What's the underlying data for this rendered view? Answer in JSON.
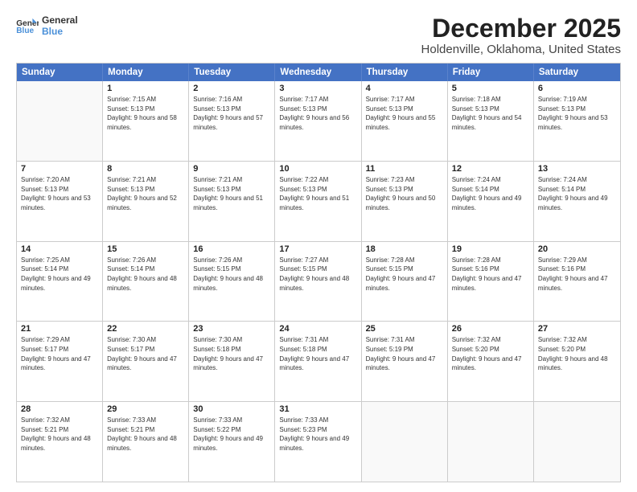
{
  "header": {
    "logo_line1": "General",
    "logo_line2": "Blue",
    "title": "December 2025",
    "subtitle": "Holdenville, Oklahoma, United States"
  },
  "days_of_week": [
    "Sunday",
    "Monday",
    "Tuesday",
    "Wednesday",
    "Thursday",
    "Friday",
    "Saturday"
  ],
  "weeks": [
    [
      {
        "day": "",
        "empty": true
      },
      {
        "day": "1",
        "sunrise": "7:15 AM",
        "sunset": "5:13 PM",
        "daylight": "9 hours and 58 minutes."
      },
      {
        "day": "2",
        "sunrise": "7:16 AM",
        "sunset": "5:13 PM",
        "daylight": "9 hours and 57 minutes."
      },
      {
        "day": "3",
        "sunrise": "7:17 AM",
        "sunset": "5:13 PM",
        "daylight": "9 hours and 56 minutes."
      },
      {
        "day": "4",
        "sunrise": "7:17 AM",
        "sunset": "5:13 PM",
        "daylight": "9 hours and 55 minutes."
      },
      {
        "day": "5",
        "sunrise": "7:18 AM",
        "sunset": "5:13 PM",
        "daylight": "9 hours and 54 minutes."
      },
      {
        "day": "6",
        "sunrise": "7:19 AM",
        "sunset": "5:13 PM",
        "daylight": "9 hours and 53 minutes."
      }
    ],
    [
      {
        "day": "7",
        "sunrise": "7:20 AM",
        "sunset": "5:13 PM",
        "daylight": "9 hours and 53 minutes."
      },
      {
        "day": "8",
        "sunrise": "7:21 AM",
        "sunset": "5:13 PM",
        "daylight": "9 hours and 52 minutes."
      },
      {
        "day": "9",
        "sunrise": "7:21 AM",
        "sunset": "5:13 PM",
        "daylight": "9 hours and 51 minutes."
      },
      {
        "day": "10",
        "sunrise": "7:22 AM",
        "sunset": "5:13 PM",
        "daylight": "9 hours and 51 minutes."
      },
      {
        "day": "11",
        "sunrise": "7:23 AM",
        "sunset": "5:13 PM",
        "daylight": "9 hours and 50 minutes."
      },
      {
        "day": "12",
        "sunrise": "7:24 AM",
        "sunset": "5:14 PM",
        "daylight": "9 hours and 49 minutes."
      },
      {
        "day": "13",
        "sunrise": "7:24 AM",
        "sunset": "5:14 PM",
        "daylight": "9 hours and 49 minutes."
      }
    ],
    [
      {
        "day": "14",
        "sunrise": "7:25 AM",
        "sunset": "5:14 PM",
        "daylight": "9 hours and 49 minutes."
      },
      {
        "day": "15",
        "sunrise": "7:26 AM",
        "sunset": "5:14 PM",
        "daylight": "9 hours and 48 minutes."
      },
      {
        "day": "16",
        "sunrise": "7:26 AM",
        "sunset": "5:15 PM",
        "daylight": "9 hours and 48 minutes."
      },
      {
        "day": "17",
        "sunrise": "7:27 AM",
        "sunset": "5:15 PM",
        "daylight": "9 hours and 48 minutes."
      },
      {
        "day": "18",
        "sunrise": "7:28 AM",
        "sunset": "5:15 PM",
        "daylight": "9 hours and 47 minutes."
      },
      {
        "day": "19",
        "sunrise": "7:28 AM",
        "sunset": "5:16 PM",
        "daylight": "9 hours and 47 minutes."
      },
      {
        "day": "20",
        "sunrise": "7:29 AM",
        "sunset": "5:16 PM",
        "daylight": "9 hours and 47 minutes."
      }
    ],
    [
      {
        "day": "21",
        "sunrise": "7:29 AM",
        "sunset": "5:17 PM",
        "daylight": "9 hours and 47 minutes."
      },
      {
        "day": "22",
        "sunrise": "7:30 AM",
        "sunset": "5:17 PM",
        "daylight": "9 hours and 47 minutes."
      },
      {
        "day": "23",
        "sunrise": "7:30 AM",
        "sunset": "5:18 PM",
        "daylight": "9 hours and 47 minutes."
      },
      {
        "day": "24",
        "sunrise": "7:31 AM",
        "sunset": "5:18 PM",
        "daylight": "9 hours and 47 minutes."
      },
      {
        "day": "25",
        "sunrise": "7:31 AM",
        "sunset": "5:19 PM",
        "daylight": "9 hours and 47 minutes."
      },
      {
        "day": "26",
        "sunrise": "7:32 AM",
        "sunset": "5:20 PM",
        "daylight": "9 hours and 47 minutes."
      },
      {
        "day": "27",
        "sunrise": "7:32 AM",
        "sunset": "5:20 PM",
        "daylight": "9 hours and 48 minutes."
      }
    ],
    [
      {
        "day": "28",
        "sunrise": "7:32 AM",
        "sunset": "5:21 PM",
        "daylight": "9 hours and 48 minutes."
      },
      {
        "day": "29",
        "sunrise": "7:33 AM",
        "sunset": "5:21 PM",
        "daylight": "9 hours and 48 minutes."
      },
      {
        "day": "30",
        "sunrise": "7:33 AM",
        "sunset": "5:22 PM",
        "daylight": "9 hours and 49 minutes."
      },
      {
        "day": "31",
        "sunrise": "7:33 AM",
        "sunset": "5:23 PM",
        "daylight": "9 hours and 49 minutes."
      },
      {
        "day": "",
        "empty": true
      },
      {
        "day": "",
        "empty": true
      },
      {
        "day": "",
        "empty": true
      }
    ]
  ]
}
